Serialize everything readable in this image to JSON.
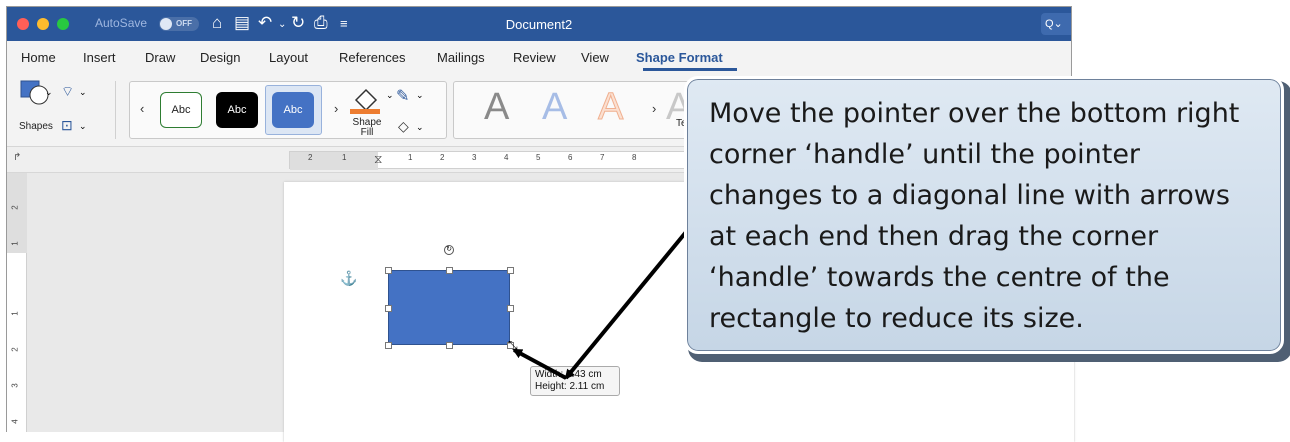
{
  "window": {
    "title": "Document2",
    "autosave_label": "AutoSave",
    "autosave_state": "OFF",
    "search_label": "Q⌄"
  },
  "tabs": [
    "Home",
    "Insert",
    "Draw",
    "Design",
    "Layout",
    "References",
    "Mailings",
    "Review",
    "View",
    "Shape Format"
  ],
  "active_tab": "Shape Format",
  "ribbon": {
    "shapes_label": "Shapes",
    "shape_fill_label": "Shape Fill",
    "style_gallery": [
      "Abc",
      "Abc",
      "Abc"
    ],
    "wordart_letter": "A",
    "text_label": "Te"
  },
  "ruler": {
    "h_numbers": [
      "2",
      "1",
      "1",
      "2",
      "3",
      "4",
      "5",
      "6",
      "7",
      "8"
    ],
    "v_numbers": [
      "2",
      "1",
      "1",
      "2",
      "3",
      "4"
    ]
  },
  "tooltip": {
    "width_line": "Width: 3.43 cm",
    "height_line": "Height: 2.11 cm"
  },
  "callout": {
    "text": "Move the pointer over the bottom right corner ‘handle’ until the pointer changes to a diagonal line with arrows at each end then drag the corner ‘handle’ towards the centre of the rectangle to reduce its size."
  },
  "colors": {
    "title_bar": "#2b579a",
    "rectangle_fill": "#4472c4",
    "callout_fill": "#d3e1ee"
  },
  "icons": [
    "home-icon",
    "save-icon",
    "undo-icon",
    "redo-icon",
    "print-icon",
    "customize-icon",
    "anchor-icon",
    "rotate-handle-icon",
    "resize-cursor-icon"
  ]
}
